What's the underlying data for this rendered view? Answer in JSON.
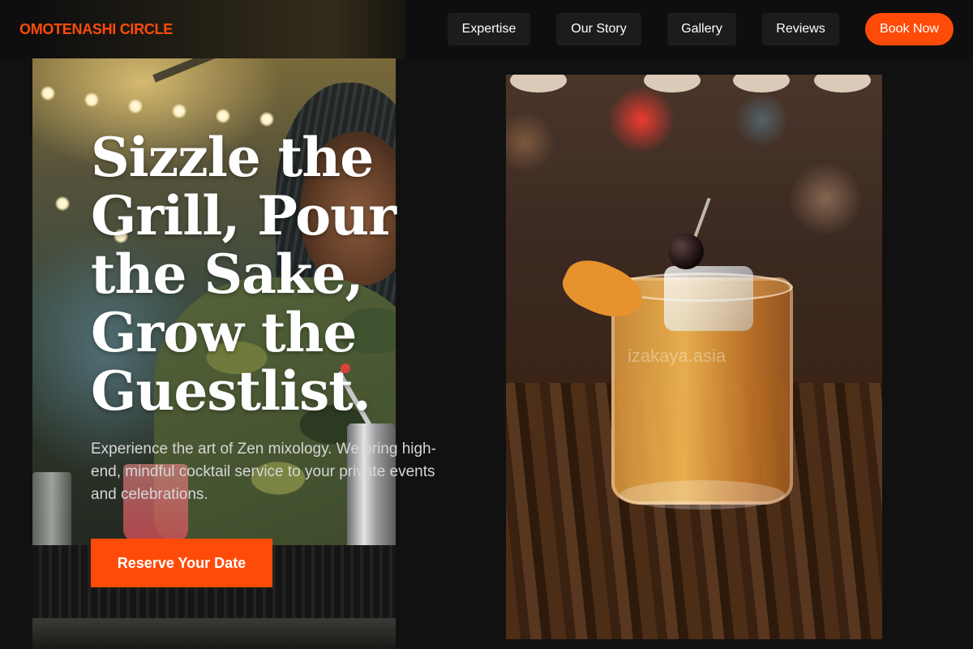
{
  "header": {
    "logo": "OMOTENASHI CIRCLE",
    "nav": [
      "Expertise",
      "Our Story",
      "Gallery",
      "Reviews"
    ],
    "cta": "Book Now"
  },
  "hero": {
    "title": "Sizzle the Grill, Pour the Sake, Grow the Guestlist.",
    "description": "Experience the art of Zen mixology. We bring high-end, mindful cocktail service to your private events and celebrations.",
    "cta": "Reserve Your Date"
  },
  "gallery": {
    "cocktail_watermark": "izakaya.asia"
  },
  "colors": {
    "accent": "#ff4b0a",
    "background": "#111111",
    "nav_button": "#1c1c1c",
    "text_primary": "#ffffff",
    "text_secondary": "#d6d6d6"
  },
  "icons": {
    "hero_image": "bartender-photo",
    "side_image": "cocktail-photo"
  }
}
